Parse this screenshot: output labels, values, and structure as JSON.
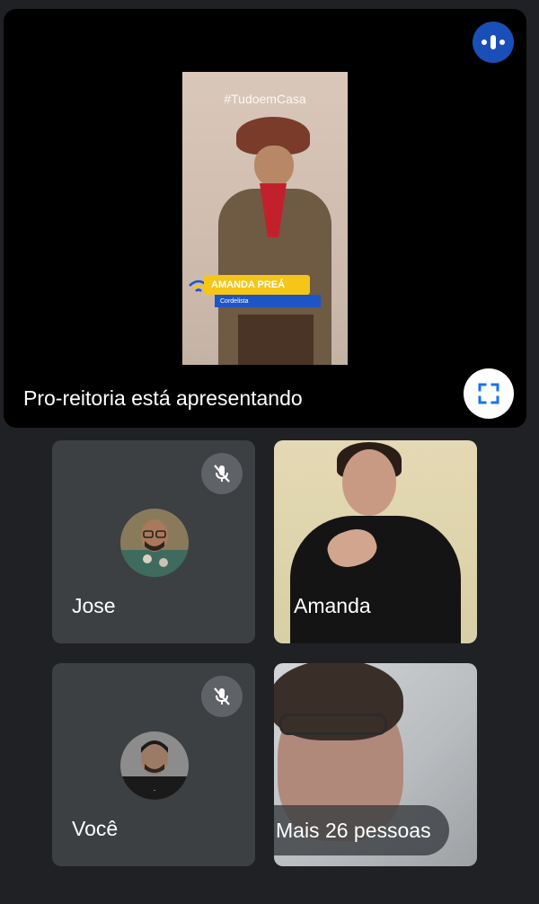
{
  "presentation": {
    "label": "Pro-reitoria está apresentando",
    "shared_content": {
      "hashtag": "#TudoemCasa",
      "lower_third_name": "AMANDA PREÁ",
      "lower_third_role": "Cordelista"
    }
  },
  "participants": [
    {
      "name": "Jose",
      "muted": true,
      "video": false
    },
    {
      "name": "Amanda",
      "muted": false,
      "video": true
    },
    {
      "name": "Você",
      "muted": true,
      "video": false
    },
    {
      "name": "Mais 26 pessoas",
      "muted": false,
      "video": true
    }
  ],
  "colors": {
    "background": "#202124",
    "tile": "#3c4043",
    "speaking_indicator": "#1a4fb8",
    "mute_badge": "#5f6368"
  },
  "icons": {
    "speaking": "audio-level-icon",
    "fullscreen": "fullscreen-icon",
    "muted": "mic-off-icon"
  }
}
